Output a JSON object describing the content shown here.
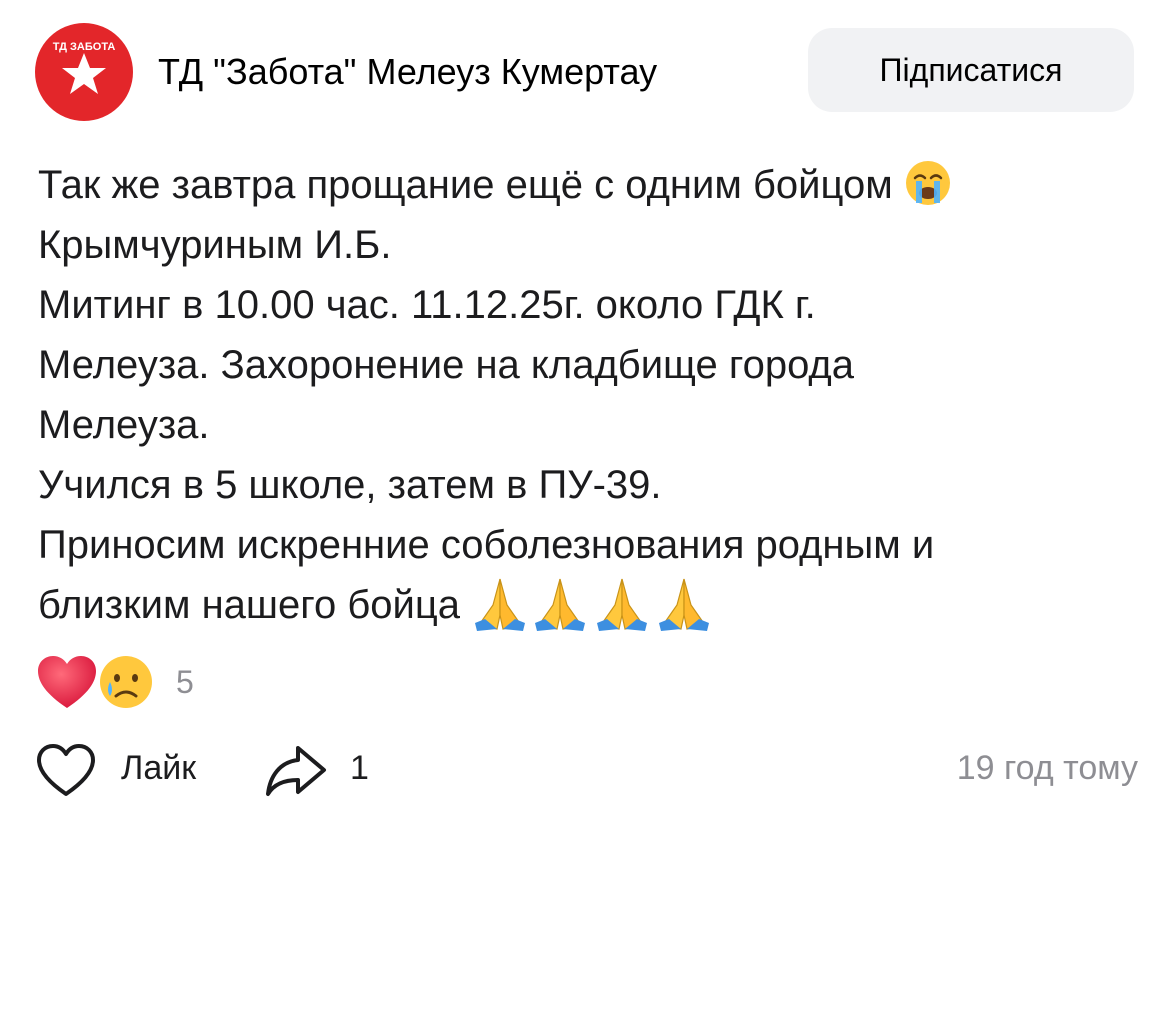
{
  "channel": {
    "name": "ТД \"Забота\" Мелеуз Кумертау",
    "avatar_text": "ТД ЗАБОТА",
    "brand_color": "#e3262a"
  },
  "subscribe": {
    "label": "Підписатися"
  },
  "post": {
    "lines": [
      "Так же завтра прощание ещё с одним бойцом",
      "Крымчуриным И.Б.",
      "Митинг в 10.00 час. 11.12.25г. около ГДК г.",
      "Мелеуза. Захоронение на кладбище города",
      "Мелеуза.",
      "Учился в 5 школе, затем в ПУ-39.",
      "Приносим искренние соболезнования родным и",
      "близким нашего бойца"
    ],
    "emojis": {
      "line1": "loudly-crying-face",
      "line8": [
        "folded-hands",
        "folded-hands",
        "folded-hands",
        "folded-hands"
      ]
    }
  },
  "reactions": {
    "icons": [
      "red-heart",
      "crying-face"
    ],
    "count": "5"
  },
  "actions": {
    "like_label": "Лайк",
    "share_count": "1",
    "timestamp": "19 год тому"
  }
}
